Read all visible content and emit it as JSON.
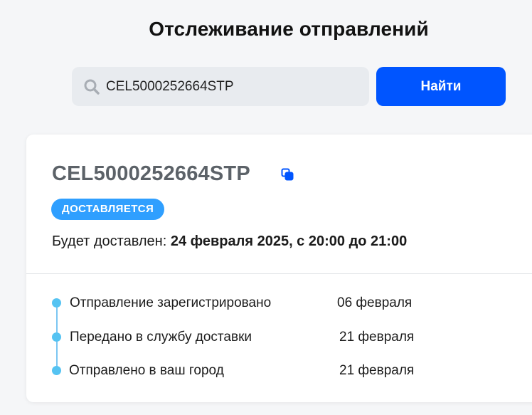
{
  "header": {
    "title": "Отслеживание отправлений"
  },
  "search": {
    "value": "CEL5000252664STP",
    "icon": "search-icon",
    "button_label": "Найти",
    "button_color": "#0055ff"
  },
  "shipment": {
    "track_number": "CEL5000252664STP",
    "copy_icon": "copy-icon",
    "status": "ДОСТАВЛЯЕТСЯ",
    "status_color": "#2f9fff",
    "delivery_prefix": "Будет доставлен: ",
    "delivery_date": "24 февраля 2025, с 20:00 до 21:00",
    "timeline": [
      {
        "label": "Отправление зарегистрировано",
        "date": "06 февраля"
      },
      {
        "label": "Передано в службу доставки",
        "date": "21 февраля"
      },
      {
        "label": "Отправлено в ваш город",
        "date": "21 февраля"
      }
    ]
  }
}
